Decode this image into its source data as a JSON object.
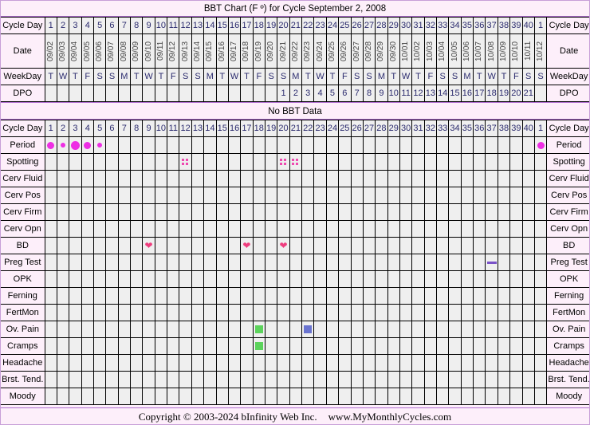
{
  "chart_data": {
    "type": "table",
    "title": "BBT Chart (F º) for Cycle September 2, 2008",
    "xlabel": "Cycle Day",
    "ylabel": "",
    "bbt_status": "No BBT Data",
    "cycle_days": [
      1,
      2,
      3,
      4,
      5,
      6,
      7,
      8,
      9,
      10,
      11,
      12,
      13,
      14,
      15,
      16,
      17,
      18,
      19,
      20,
      21,
      22,
      23,
      24,
      25,
      26,
      27,
      28,
      29,
      30,
      31,
      32,
      33,
      34,
      35,
      36,
      37,
      38,
      39,
      40,
      1
    ],
    "dates": [
      "09/02",
      "09/03",
      "09/04",
      "09/05",
      "09/06",
      "09/07",
      "09/08",
      "09/09",
      "09/10",
      "09/11",
      "09/12",
      "09/13",
      "09/14",
      "09/15",
      "09/16",
      "09/17",
      "09/18",
      "09/19",
      "09/20",
      "09/21",
      "09/22",
      "09/23",
      "09/24",
      "09/25",
      "09/26",
      "09/27",
      "09/28",
      "09/29",
      "09/30",
      "10/01",
      "10/02",
      "10/03",
      "10/04",
      "10/05",
      "10/06",
      "10/07",
      "10/08",
      "10/09",
      "10/10",
      "10/11",
      "10/12"
    ],
    "weekdays": [
      "T",
      "W",
      "T",
      "F",
      "S",
      "S",
      "M",
      "T",
      "W",
      "T",
      "F",
      "S",
      "S",
      "M",
      "T",
      "W",
      "T",
      "F",
      "S",
      "S",
      "M",
      "T",
      "W",
      "T",
      "F",
      "S",
      "S",
      "M",
      "T",
      "W",
      "T",
      "F",
      "S",
      "S",
      "M",
      "T",
      "W",
      "T",
      "F",
      "S",
      "S"
    ],
    "dpo": [
      "",
      "",
      "",
      "",
      "",
      "",
      "",
      "",
      "",
      "",
      "",
      "",
      "",
      "",
      "",
      "",
      "",
      "",
      "",
      "1",
      "2",
      "3",
      "4",
      "5",
      "6",
      "7",
      "8",
      "9",
      "10",
      "11",
      "12",
      "13",
      "14",
      "15",
      "16",
      "17",
      "18",
      "19",
      "20",
      "21",
      ""
    ],
    "series": [
      {
        "name": "Period",
        "markers": {
          "1": "medium",
          "2": "light",
          "3": "heavy",
          "4": "medium",
          "5": "light",
          "41": "medium"
        }
      },
      {
        "name": "Spotting",
        "markers": {
          "12": "spot",
          "20": "spot",
          "21": "spot"
        }
      },
      {
        "name": "Cerv Fluid",
        "markers": {}
      },
      {
        "name": "Cerv Pos",
        "markers": {}
      },
      {
        "name": "Cerv Firm",
        "markers": {}
      },
      {
        "name": "Cerv Opn",
        "markers": {}
      },
      {
        "name": "BD",
        "markers": {
          "9": "heart",
          "17": "heart",
          "20": "heart"
        }
      },
      {
        "name": "Preg Test",
        "markers": {
          "37": "dash"
        }
      },
      {
        "name": "OPK",
        "markers": {}
      },
      {
        "name": "Ferning",
        "markers": {}
      },
      {
        "name": "FertMon",
        "markers": {}
      },
      {
        "name": "Ov. Pain",
        "markers": {
          "18": "green",
          "22": "blue"
        }
      },
      {
        "name": "Cramps",
        "markers": {
          "18": "green"
        }
      },
      {
        "name": "Headache",
        "markers": {}
      },
      {
        "name": "Brst. Tend.",
        "markers": {}
      },
      {
        "name": "Moody",
        "markers": {}
      }
    ],
    "colors": {
      "period": "#ee2ee4",
      "spotting": "#ee4bb0",
      "bd": "#ef3d7e",
      "ov_pain_green": "#5cd35c",
      "ov_pain_blue": "#6a74d0",
      "preg_test": "#7a52c8",
      "background": "#fdeffa",
      "border": "#b06fd0"
    }
  },
  "header": {
    "title": "BBT Chart (F º) for Cycle September 2, 2008"
  },
  "rows": {
    "cycle_day_label": "Cycle Day",
    "date_label": "Date",
    "weekday_label": "WeekDay",
    "dpo_label": "DPO",
    "no_bbt": "No BBT Data"
  },
  "footer": {
    "copyright": "Copyright © 2003-2024 bInfinity Web Inc.",
    "site": "www.MyMonthlyCycles.com"
  }
}
